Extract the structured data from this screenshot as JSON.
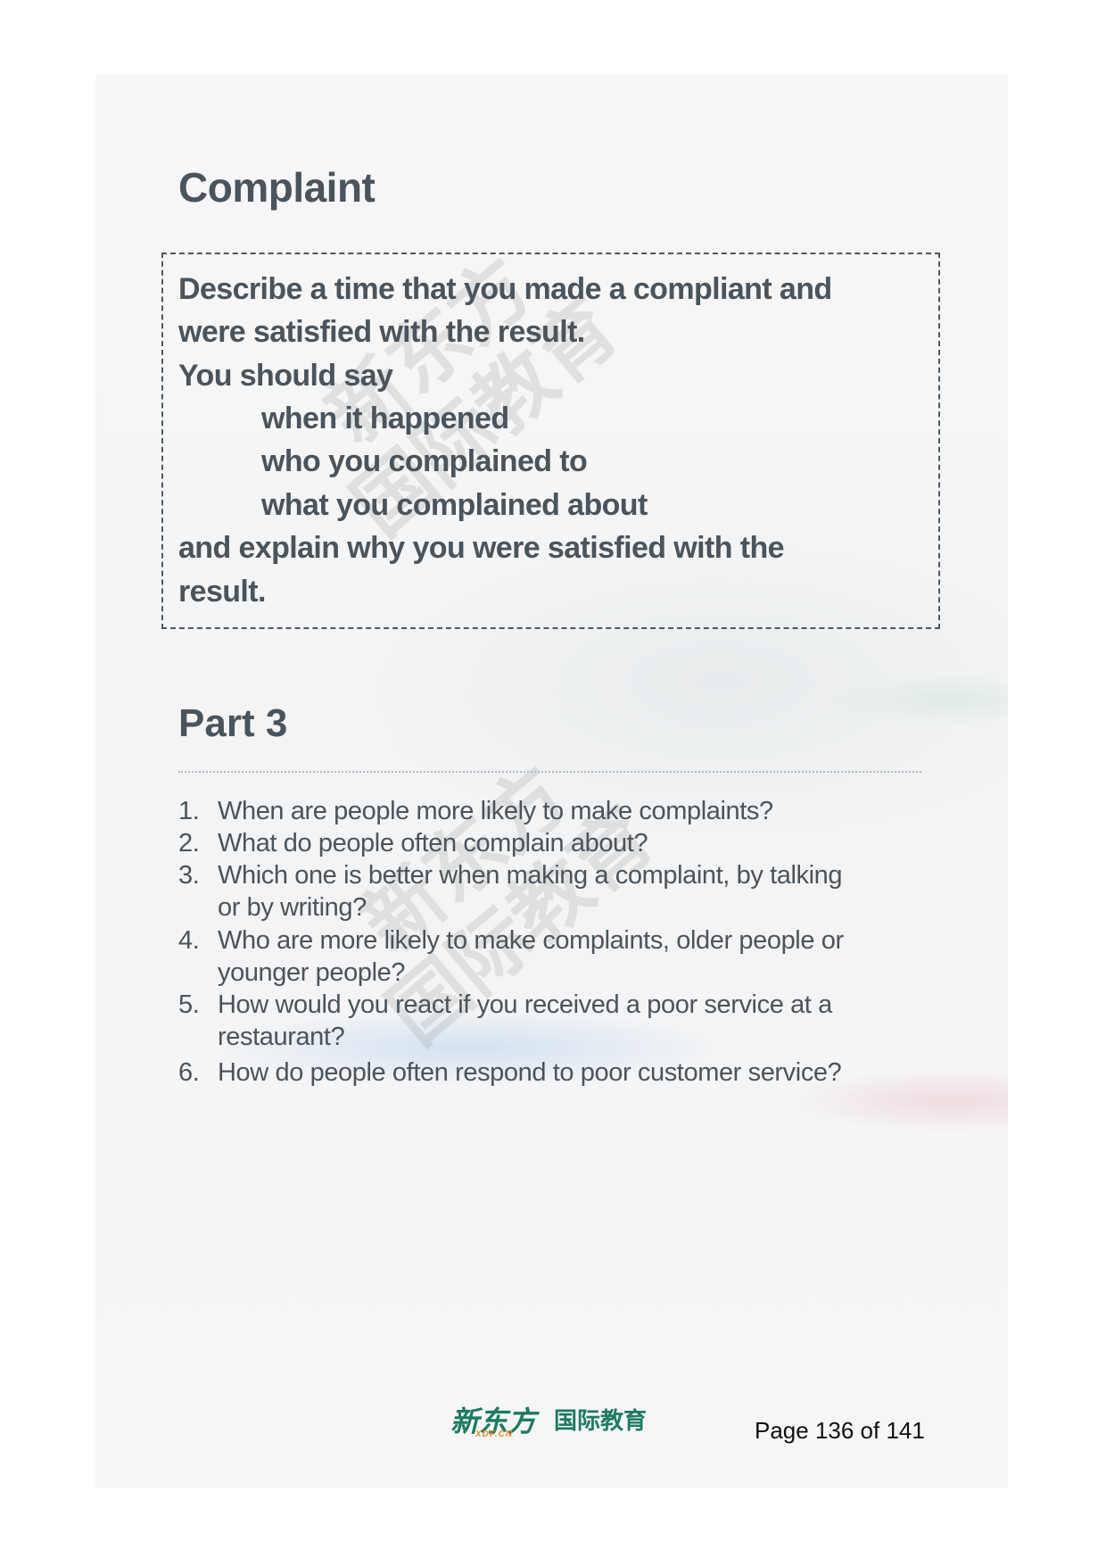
{
  "section_title": "Complaint",
  "cue_card": {
    "lines": [
      "Describe a time that you made a compliant and",
      "were satisfied with the result.",
      "You should say",
      "when it happened",
      "who you complained to",
      "what you complained about",
      "and explain why you were satisfied with the",
      "result."
    ]
  },
  "part_title": "Part 3",
  "questions": [
    {
      "num": "1.",
      "lines": [
        "When are people more likely to make complaints?"
      ]
    },
    {
      "num": "2.",
      "lines": [
        "What do people often complain about?"
      ]
    },
    {
      "num": "3.",
      "lines": [
        "Which one is better when making a complaint, by talking",
        "or by writing?"
      ]
    },
    {
      "num": "4.",
      "lines": [
        "Who are more likely to make complaints, older people or",
        "younger people?"
      ]
    },
    {
      "num": "5.",
      "lines": [
        "How would you react if you received a poor service at a",
        "restaurant?"
      ]
    },
    {
      "num": "6.",
      "lines": [
        "How do people often respond to poor customer service?"
      ]
    }
  ],
  "watermark": {
    "line1": "新东方",
    "line2": "国际教育"
  },
  "footer": {
    "logo_main": "新东方",
    "logo_sub": "XDF.CN",
    "logo_cn": "国际教育",
    "page_label": "Page 136 of 141",
    "brand_color": "#1e7a63"
  }
}
